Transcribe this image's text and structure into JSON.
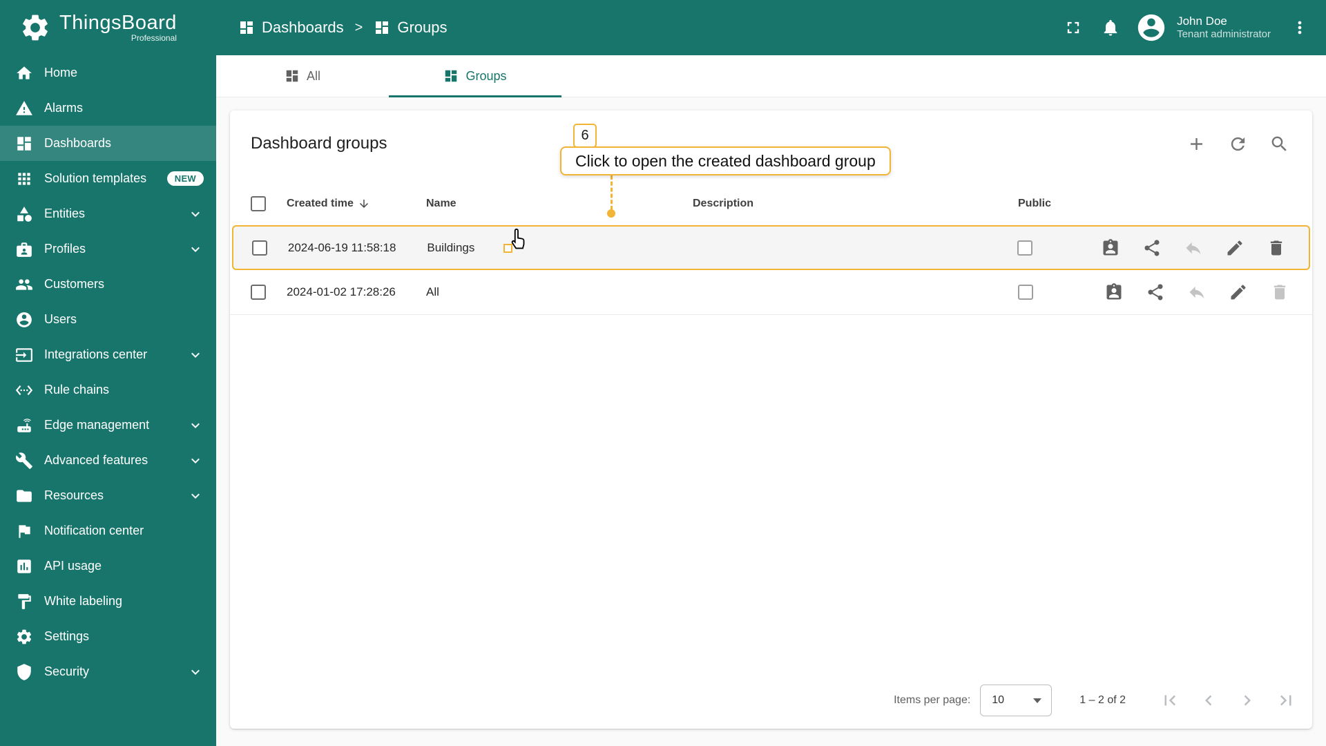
{
  "colors": {
    "primary": "#17756b",
    "accent": "#f2b434"
  },
  "app": {
    "brand": "ThingsBoard",
    "edition": "Professional"
  },
  "header": {
    "separator": ">",
    "breadcrumbs": [
      {
        "label": "Dashboards",
        "icon": "dashboards"
      },
      {
        "label": "Groups",
        "icon": "dashboards"
      }
    ],
    "user": {
      "name": "John Doe",
      "role": "Tenant administrator"
    }
  },
  "sidebar": {
    "items": [
      {
        "label": "Home",
        "icon": "home"
      },
      {
        "label": "Alarms",
        "icon": "alarms"
      },
      {
        "label": "Dashboards",
        "icon": "dashboards",
        "active": true
      },
      {
        "label": "Solution templates",
        "icon": "solution-templates",
        "badge": "NEW"
      },
      {
        "label": "Entities",
        "icon": "entities",
        "expandable": true
      },
      {
        "label": "Profiles",
        "icon": "profiles",
        "expandable": true
      },
      {
        "label": "Customers",
        "icon": "customers"
      },
      {
        "label": "Users",
        "icon": "users"
      },
      {
        "label": "Integrations center",
        "icon": "integrations",
        "expandable": true
      },
      {
        "label": "Rule chains",
        "icon": "rule-chains"
      },
      {
        "label": "Edge management",
        "icon": "edge",
        "expandable": true
      },
      {
        "label": "Advanced features",
        "icon": "advanced",
        "expandable": true
      },
      {
        "label": "Resources",
        "icon": "resources",
        "expandable": true
      },
      {
        "label": "Notification center",
        "icon": "notification"
      },
      {
        "label": "API usage",
        "icon": "api-usage"
      },
      {
        "label": "White labeling",
        "icon": "white-labeling"
      },
      {
        "label": "Settings",
        "icon": "settings"
      },
      {
        "label": "Security",
        "icon": "security",
        "expandable": true
      }
    ]
  },
  "tabs": [
    {
      "label": "All",
      "icon": "dashboards",
      "active": false
    },
    {
      "label": "Groups",
      "icon": "dashboards",
      "active": true
    }
  ],
  "table": {
    "title": "Dashboard groups",
    "toolbar": [
      {
        "icon": "add"
      },
      {
        "icon": "refresh"
      },
      {
        "icon": "search"
      }
    ],
    "columns": [
      {
        "label": "Created time",
        "sorted": "desc"
      },
      {
        "label": "Name"
      },
      {
        "label": "Description"
      },
      {
        "label": "Public"
      }
    ],
    "rows": [
      {
        "created_time": "2024-06-19 11:58:18",
        "name": "Buildings",
        "description": "",
        "public": false,
        "highlighted": true,
        "actions": [
          {
            "icon": "manage-users",
            "enabled": true
          },
          {
            "icon": "share",
            "enabled": true
          },
          {
            "icon": "make-private",
            "enabled": false
          },
          {
            "icon": "edit",
            "enabled": true
          },
          {
            "icon": "delete",
            "enabled": true
          }
        ]
      },
      {
        "created_time": "2024-01-02 17:28:26",
        "name": "All",
        "description": "",
        "public": false,
        "highlighted": false,
        "actions": [
          {
            "icon": "manage-users",
            "enabled": true
          },
          {
            "icon": "share",
            "enabled": true
          },
          {
            "icon": "make-private",
            "enabled": false
          },
          {
            "icon": "edit",
            "enabled": true
          },
          {
            "icon": "delete",
            "enabled": false
          }
        ]
      }
    ]
  },
  "tutorial": {
    "step": "6",
    "tooltip": "Click to open the created dashboard group"
  },
  "paginator": {
    "items_per_page_label": "Items per page:",
    "page_size": "10",
    "range": "1 – 2 of 2"
  }
}
